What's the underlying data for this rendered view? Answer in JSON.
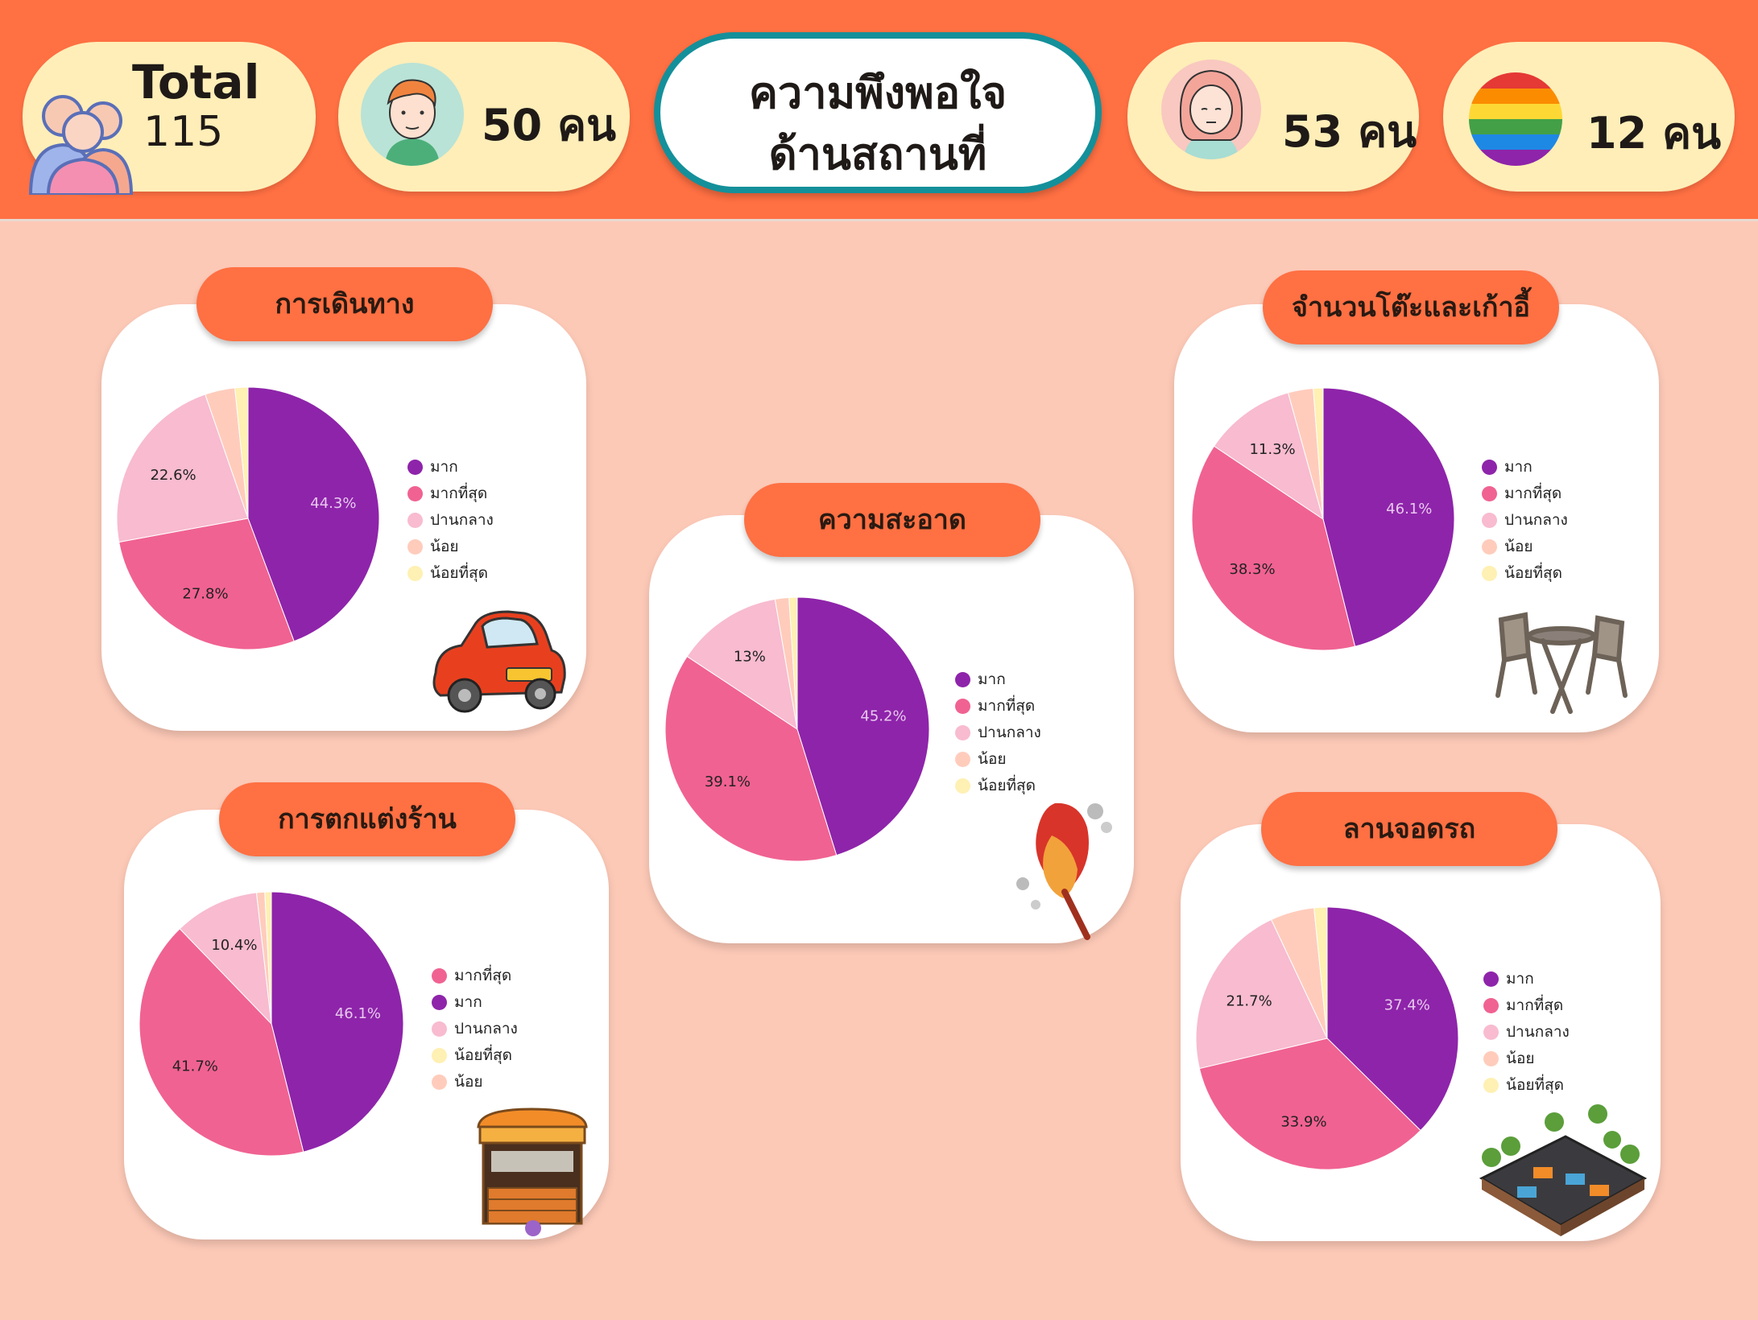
{
  "header": {
    "title_line1": "ความพึงพอใจ",
    "title_line2": "ด้านสถานที่",
    "total_label": "Total",
    "total_value": "115",
    "male_count": "50 คน",
    "female_count": "53 คน",
    "lgbt_count": "12 คน"
  },
  "colors": {
    "purple": "#8e24aa",
    "pink": "#f06292",
    "light_pink": "#f8bbd0",
    "peach": "#ffccbc",
    "cream": "#fff0b3",
    "orange": "#ff7043",
    "teal": "#14909a"
  },
  "chart_data": [
    {
      "type": "pie",
      "title": "การเดินทาง",
      "legend": [
        "มาก",
        "มากที่สุด",
        "ปานกลาง",
        "น้อย",
        "น้อยที่สุด"
      ],
      "values": [
        44.3,
        27.8,
        22.6,
        3.7,
        1.6
      ],
      "labels": [
        "44.3%",
        "27.8%",
        "22.6%",
        "",
        ""
      ],
      "icon": "car-icon"
    },
    {
      "type": "pie",
      "title": "จำนวนโต๊ะและเก้าอี้",
      "legend": [
        "มาก",
        "มากที่สุด",
        "ปานกลาง",
        "น้อย",
        "น้อยที่สุด"
      ],
      "values": [
        46.1,
        38.3,
        11.3,
        3.1,
        1.2
      ],
      "labels": [
        "46.1%",
        "38.3%",
        "11.3%",
        "",
        ""
      ],
      "icon": "table-chairs-icon"
    },
    {
      "type": "pie",
      "title": "ความสะอาด",
      "legend": [
        "มาก",
        "มากที่สุด",
        "ปานกลาง",
        "น้อย",
        "น้อยที่สุด"
      ],
      "values": [
        45.2,
        39.1,
        13.0,
        1.7,
        1.0
      ],
      "labels": [
        "45.2%",
        "39.1%",
        "13%",
        "",
        ""
      ],
      "icon": "feather-duster-icon"
    },
    {
      "type": "pie",
      "title": "การตกแต่งร้าน",
      "legend": [
        "มากที่สุด",
        "มาก",
        "ปานกลาง",
        "น้อยที่สุด",
        "น้อย"
      ],
      "values": [
        46.1,
        41.7,
        10.4,
        1.0,
        0.8
      ],
      "labels": [
        "46.1%",
        "41.7%",
        "10.4%",
        "",
        ""
      ],
      "icon": "cafe-shop-icon"
    },
    {
      "type": "pie",
      "title": "ลานจอดรถ",
      "legend": [
        "มาก",
        "มากที่สุด",
        "ปานกลาง",
        "น้อย",
        "น้อยที่สุด"
      ],
      "values": [
        37.4,
        33.9,
        21.7,
        5.4,
        1.6
      ],
      "labels": [
        "37.4%",
        "33.9%",
        "21.7%",
        "",
        ""
      ],
      "icon": "parking-lot-icon"
    }
  ]
}
